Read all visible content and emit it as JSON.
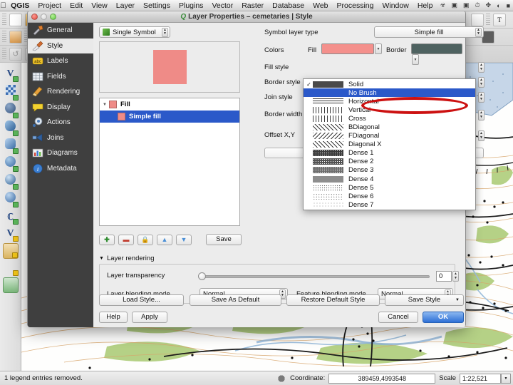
{
  "macmenu": {
    "apple": "apple-logo",
    "items": [
      "QGIS",
      "Project",
      "Edit",
      "View",
      "Layer",
      "Settings",
      "Plugins",
      "Vector",
      "Raster",
      "Database",
      "Web",
      "Processing",
      "Window",
      "Help"
    ],
    "status_icons": [
      "dropbox-icon",
      "airplay-icon",
      "display-icon",
      "timemachine-icon",
      "bluetooth-icon",
      "wifi-icon",
      "battery-icon"
    ]
  },
  "dialog": {
    "title": "Layer Properties – cemetaries | Style",
    "title_icon": "qgis-logo-icon",
    "window_buttons": [
      "close-button",
      "minimize-button",
      "zoom-button"
    ],
    "categories": [
      {
        "label": "General",
        "icon": "wrench-icon",
        "selected": false
      },
      {
        "label": "Style",
        "icon": "brush-icon",
        "selected": true
      },
      {
        "label": "Labels",
        "icon": "abc-icon",
        "selected": false
      },
      {
        "label": "Fields",
        "icon": "table-icon",
        "selected": false
      },
      {
        "label": "Rendering",
        "icon": "broom-icon",
        "selected": false
      },
      {
        "label": "Display",
        "icon": "speech-icon",
        "selected": false
      },
      {
        "label": "Actions",
        "icon": "gear-icon",
        "selected": false
      },
      {
        "label": "Joins",
        "icon": "join-icon",
        "selected": false
      },
      {
        "label": "Diagrams",
        "icon": "chart-icon",
        "selected": false
      },
      {
        "label": "Metadata",
        "icon": "info-icon",
        "selected": false
      }
    ],
    "renderer": {
      "value": "Single Symbol",
      "icon": "single-symbol-icon"
    },
    "preview": {
      "fill_color": "#ef8b87"
    },
    "symbol_tree": [
      {
        "label": "Fill",
        "color": "#ef8b87",
        "selected": false,
        "level": 0
      },
      {
        "label": "Simple fill",
        "color": "#ef8b87",
        "selected": true,
        "level": 1
      }
    ],
    "layer_buttons": {
      "add": "+",
      "remove": "–",
      "lock": "lock-icon",
      "up": "▲",
      "down": "▼",
      "save_label": "Save"
    },
    "properties": {
      "symbol_layer_type_label": "Symbol layer type",
      "symbol_layer_type_value": "Simple fill",
      "colors_label": "Colors",
      "fill_label": "Fill",
      "fill_color": "#f4908c",
      "border_label": "Border",
      "border_color": "#4e6260",
      "fill_style_label": "Fill style",
      "border_style_label": "Border style",
      "join_style_label": "Join style",
      "border_width_label": "Border width",
      "offset_label": "Offset X,Y"
    },
    "fill_style_options": [
      {
        "label": "Solid",
        "pattern": "solid",
        "checked": true,
        "selected": false
      },
      {
        "label": "No Brush",
        "pattern": "none",
        "checked": false,
        "selected": true
      },
      {
        "label": "Horizontal",
        "pattern": "horiz",
        "checked": false,
        "selected": false
      },
      {
        "label": "Vertical",
        "pattern": "vert",
        "checked": false,
        "selected": false
      },
      {
        "label": "Cross",
        "pattern": "cross",
        "checked": false,
        "selected": false
      },
      {
        "label": "BDiagonal",
        "pattern": "bdiag",
        "checked": false,
        "selected": false
      },
      {
        "label": "FDiagonal",
        "pattern": "fdiag",
        "checked": false,
        "selected": false
      },
      {
        "label": "Diagonal X",
        "pattern": "diagx",
        "checked": false,
        "selected": false
      },
      {
        "label": "Dense 1",
        "pattern": "dense1",
        "checked": false,
        "selected": false
      },
      {
        "label": "Dense 2",
        "pattern": "dense2",
        "checked": false,
        "selected": false
      },
      {
        "label": "Dense 3",
        "pattern": "dense3",
        "checked": false,
        "selected": false
      },
      {
        "label": "Dense 4",
        "pattern": "dense4",
        "checked": false,
        "selected": false
      },
      {
        "label": "Dense 5",
        "pattern": "dense5",
        "checked": false,
        "selected": false
      },
      {
        "label": "Dense 6",
        "pattern": "dense6",
        "checked": false,
        "selected": false
      },
      {
        "label": "Dense 7",
        "pattern": "dense7",
        "checked": false,
        "selected": false
      }
    ],
    "annotation": {
      "shape": "ellipse",
      "color": "#cc1111",
      "target": "No Brush"
    },
    "layer_rendering": {
      "group_label": "Layer rendering",
      "transparency_label": "Layer transparency",
      "transparency_value": "0",
      "blend_label": "Layer blending mode",
      "blend_value": "Normal",
      "feature_blend_label": "Feature blending mode",
      "feature_blend_value": "Normal"
    },
    "footer_buttons": {
      "load_style": "Load Style...",
      "save_as_default": "Save As Default",
      "restore_default": "Restore Default Style",
      "save_style": "Save Style",
      "help": "Help",
      "apply": "Apply",
      "cancel": "Cancel",
      "ok": "OK"
    }
  },
  "statusbar": {
    "message": "1 legend entries removed.",
    "render_icon": "render-icon",
    "coordinate_label": "Coordinate:",
    "coordinate_value": "389459,4993548",
    "scale_label": "Scale",
    "scale_value": "1:22,521"
  }
}
